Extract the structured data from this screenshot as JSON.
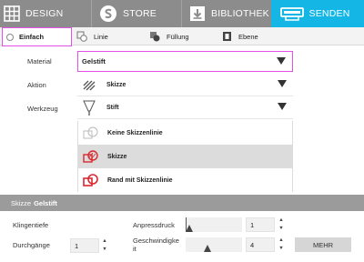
{
  "topnav": {
    "tabs": [
      {
        "label": "DESIGN",
        "icon": "grid-icon"
      },
      {
        "label": "STORE",
        "icon": "silhouette-s-icon"
      },
      {
        "label": "BIBLIOTHEK",
        "icon": "download-box-icon"
      },
      {
        "label": "SENDEN",
        "icon": "cutter-machine-icon",
        "active": true
      }
    ]
  },
  "action_tabs": [
    {
      "label": "Einfach",
      "active": true
    },
    {
      "label": "Linie"
    },
    {
      "label": "Füllung"
    },
    {
      "label": "Ebene"
    }
  ],
  "material": {
    "label": "Material",
    "value": "Gelstift"
  },
  "aktion": {
    "label": "Aktion",
    "value": "Skizze"
  },
  "werkzeug": {
    "label": "Werkzeug",
    "value": "Stift"
  },
  "sketch_options": [
    {
      "label": "Keine Skizzenlinie",
      "selected": false
    },
    {
      "label": "Skizze",
      "selected": true
    },
    {
      "label": "Rand mit Skizzenlinie",
      "selected": false
    }
  ],
  "panel": {
    "title_prefix": "Skizze",
    "title_material": "Gelstift",
    "klingentiefe_label": "Klingentiefe",
    "durchgaenge_label": "Durchgänge",
    "durchgaenge_value": "1",
    "anpressdruck_label": "Anpressdruck",
    "anpressdruck_value": "1",
    "geschwindigkeit_label": "Geschwindigke\nit",
    "geschwindigkeit_value": "4",
    "mehr_label": "MEHR"
  },
  "colors": {
    "accent": "#14b6e6",
    "nav_bg": "#8c8c8c",
    "selection_outline": "#e44fe8",
    "option_red": "#d9282f"
  }
}
